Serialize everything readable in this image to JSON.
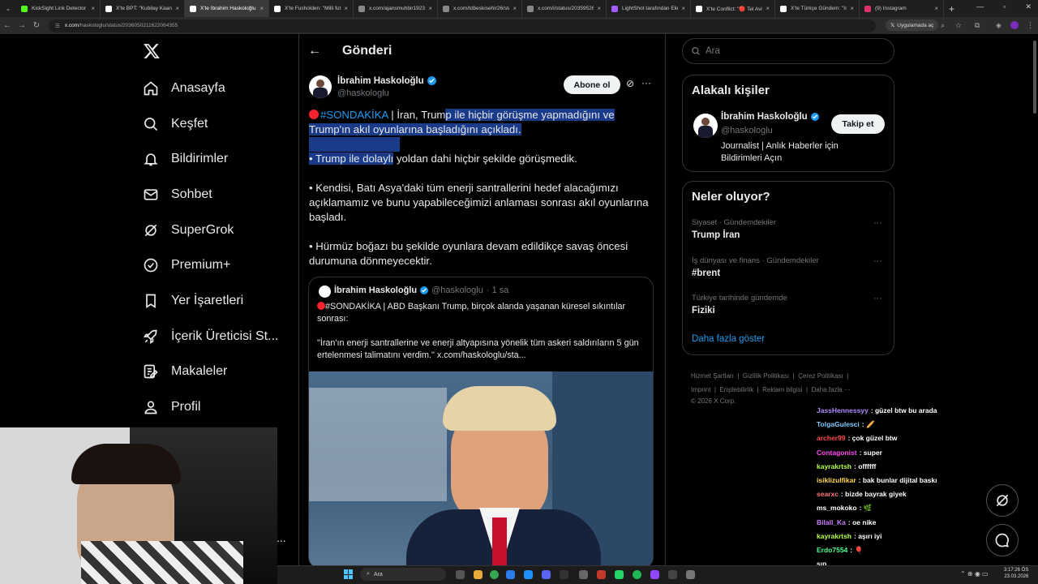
{
  "browser": {
    "tabs": [
      {
        "title": "KickSight Link Detector",
        "active": false
      },
      {
        "title": "X'te BPT: \"Kubilay Kaan K",
        "active": false
      },
      {
        "title": "X'te İbrahim Haskoloğlu",
        "active": true
      },
      {
        "title": "X'te Fusholden: \"Milli futb",
        "active": false
      },
      {
        "title": "x.com/ajansmuhbir1923/",
        "active": false
      },
      {
        "title": "x.com/tdbeskisehir26/sta",
        "active": false
      },
      {
        "title": "x.com/i/status/20359526",
        "active": false
      },
      {
        "title": "LightShot tarafından Ekra",
        "active": false
      },
      {
        "title": "X'te Conflict: \"🔴 Tel Avi",
        "active": false
      },
      {
        "title": "X'te Türkçe Gündem: \"İsr",
        "active": false
      },
      {
        "title": "(9) Instagram",
        "active": false
      }
    ],
    "url_domain": "x.com",
    "url_path": "/haskologlu/status/2036050211622064355",
    "app_button": "Uygulamada aç"
  },
  "sidebar": {
    "items": [
      {
        "label": "Anasayfa",
        "icon": "home-icon"
      },
      {
        "label": "Keşfet",
        "icon": "search-icon"
      },
      {
        "label": "Bildirimler",
        "icon": "bell-icon"
      },
      {
        "label": "Sohbet",
        "icon": "mail-icon"
      },
      {
        "label": "SuperGrok",
        "icon": "grok-icon"
      },
      {
        "label": "Premium+",
        "icon": "verified-badge-icon"
      },
      {
        "label": "Yer İşaretleri",
        "icon": "bookmark-icon"
      },
      {
        "label": "İçerik Üreticisi St...",
        "icon": "rocket-icon"
      },
      {
        "label": "Makaleler",
        "icon": "article-icon"
      },
      {
        "label": "Profil",
        "icon": "person-icon"
      }
    ],
    "more_dots": "..."
  },
  "main": {
    "header_title": "Gönderi",
    "author": {
      "name": "İbrahim Haskoloğlu",
      "handle": "@haskologlu"
    },
    "subscribe_label": "Abone ol",
    "tweet": {
      "hashtag": "#SONDAKİKA",
      "line1_a": " | İran, Trum",
      "line1_b": "p ile hiçbir görüşme yapmadığını ve",
      "line2": "Trump'ın akıl oyunlarına başladığını açıkladı.",
      "line3_a": "• Trump ile dolaylı",
      "line3_b": " yoldan dahi hiçbir şekilde görüşmedik.",
      "para2": "• Kendisi, Batı Asya'daki tüm enerji santrallerini hedef alacağımızı açıklamamız ve bunu yapabileceğimizi anlaması sonrası akıl oyunlarına başladı.",
      "para3": "• Hürmüz boğazı bu şekilde oyunlara devam edildikçe savaş öncesi durumuna dönmeyecektir."
    },
    "quote": {
      "name": "İbrahim Haskoloğlu",
      "handle": "@haskologlu",
      "time": "· 1 sa",
      "text1": "#SONDAKİKA | ABD Başkanı Trump, birçok alanda yaşanan küresel sıkıntılar sonrası:",
      "text2": "\"İran'ın enerji santrallerine ve enerji altyapısına yönelik tüm askeri saldırıların 5 gün ertelenmesi talimatını verdim.\"",
      "link": "x.com/haskologlu/sta..."
    }
  },
  "right": {
    "search_placeholder": "Ara",
    "related": {
      "title": "Alakalı kişiler",
      "name": "İbrahim Haskoloğlu",
      "handle": "@haskologlu",
      "bio": "Journalist | Anlık Haberler için Bildirimleri Açın",
      "follow_label": "Takip et"
    },
    "trends": {
      "title": "Neler oluyor?",
      "items": [
        {
          "context": "Siyaset · Gündemdekiler",
          "name": "Trump İran"
        },
        {
          "context": "İş dünyası ve finans · Gündemdekiler",
          "name": "#brent"
        },
        {
          "context": "Türkiye tarihinde gündemde",
          "name": "Fiziki"
        }
      ],
      "more": "Daha fazla göster"
    },
    "footer": {
      "links1": [
        "Hizmet Şartları",
        "Gizlilik Politikası",
        "Çerez Politikası"
      ],
      "links2": [
        "Imprint",
        "Erişilebilirlik",
        "Reklam bilgisi",
        "Daha fazla ···"
      ],
      "copyright": "© 2026 X Corp."
    }
  },
  "chat": [
    {
      "user": "JassHennessyy",
      "msg": ": güzel btw bu arada",
      "color": "#b18cff"
    },
    {
      "user": "TolgaGulesci",
      "msg": ": 🥖",
      "color": "#7ec8ff"
    },
    {
      "user": "archer99",
      "msg": ": çok güzel btw",
      "color": "#ff4d4d"
    },
    {
      "user": "Contagonist",
      "msg": ": super",
      "color": "#ff4df0"
    },
    {
      "user": "kayrakrtsh",
      "msg": ": offffff",
      "color": "#b8ff4d"
    },
    {
      "user": "isiklizulfikar",
      "msg": ": bak bunlar dijital baskı",
      "color": "#ffd84d"
    },
    {
      "user": "searxc",
      "msg": ": bizde bayrak giyek",
      "color": "#ff7a7a"
    },
    {
      "user": "ms_mokoko",
      "msg": ": 🌿",
      "color": "#ffffff"
    },
    {
      "user": "Bilall_Ka",
      "msg": ": oe nike",
      "color": "#c77dff"
    },
    {
      "user": "kayrakrtsh",
      "msg": ": aşırı iyi",
      "color": "#b8ff4d"
    },
    {
      "user": "Erdo7554",
      "msg": ": 🎈",
      "color": "#4dff88"
    },
    {
      "user": "",
      "msg": "sıp",
      "color": "#ffffff"
    }
  ],
  "taskbar": {
    "search_placeholder": "Ara",
    "time": "3:17:26 ÖS",
    "date": "23.03.2026"
  },
  "colors": {
    "accent": "#1d9bf0",
    "background": "#000000",
    "selection": "#1a3a8a"
  }
}
